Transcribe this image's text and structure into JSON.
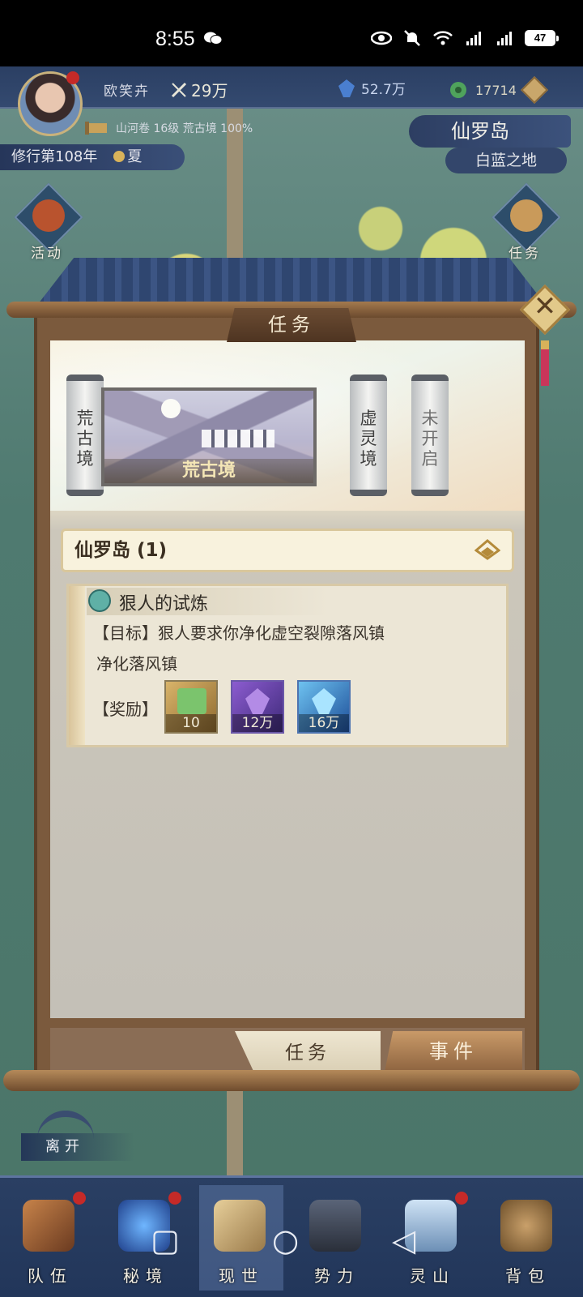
{
  "status_bar": {
    "time": "8:55",
    "battery": "47",
    "network_labels": [
      "4G",
      "5G"
    ]
  },
  "top_bar": {
    "player_name": "欧笑卉",
    "power": "29万",
    "crystal": "52.7万",
    "jade": "17714"
  },
  "scroll_info": "山河卷 16级 荒古境 100%",
  "year": "修行第108年",
  "season": "夏",
  "location": {
    "island": "仙罗岛",
    "area": "白蓝之地"
  },
  "side_buttons": {
    "activity": "活动",
    "quest": "任务"
  },
  "modal": {
    "title": "任务",
    "realms": [
      {
        "label": "荒古境",
        "state": "selected"
      },
      {
        "label": "虚灵境",
        "state": "available"
      },
      {
        "label": "未开启",
        "state": "locked"
      }
    ],
    "selected_realm_card": "荒古境",
    "group_header": "仙罗岛 (1)",
    "quest": {
      "title": "狠人的试炼",
      "goal": "【目标】狠人要求你净化虚空裂隙落风镇",
      "subtask": "净化落风镇",
      "reward_label": "【奖励】",
      "rewards": [
        {
          "item": "book-icon",
          "amount": "10"
        },
        {
          "item": "purple-crystal-icon",
          "amount": "12万"
        },
        {
          "item": "blue-crystal-icon",
          "amount": "16万"
        }
      ]
    },
    "tabs": {
      "task": "任务",
      "event": "事件"
    }
  },
  "leave_label": "离开",
  "bottom_nav": [
    {
      "label": "队伍",
      "dot": true
    },
    {
      "label": "秘境",
      "dot": true
    },
    {
      "label": "现世",
      "dot": false,
      "active": true
    },
    {
      "label": "势力",
      "dot": false
    },
    {
      "label": "灵山",
      "dot": true
    },
    {
      "label": "背包",
      "dot": false
    }
  ],
  "colors": {
    "accent_gold": "#c9a76b",
    "nav_blue": "#2a3f63",
    "notification_red": "#c52a28"
  }
}
